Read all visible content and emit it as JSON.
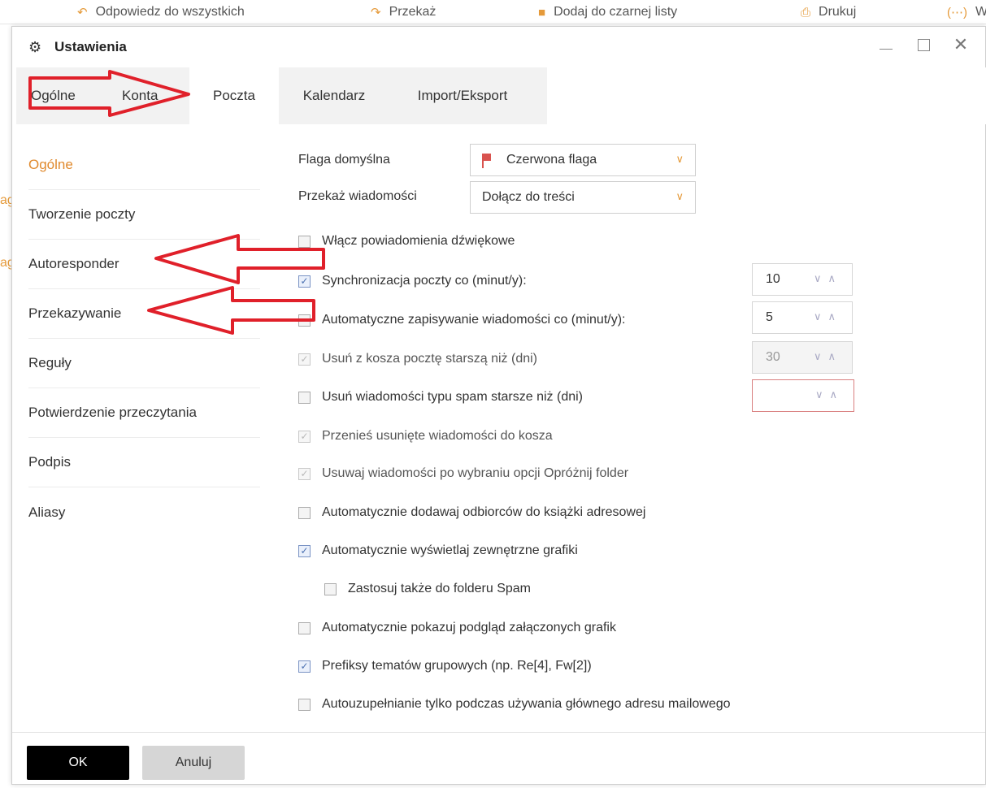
{
  "background_toolbar": {
    "items": [
      {
        "icon": "reply-all-icon",
        "label": "Odpowiedz do wszystkich"
      },
      {
        "icon": "forward-icon",
        "label": "Przekaż"
      },
      {
        "icon": "blacklist-icon",
        "label": "Dodaj do czarnej listy"
      },
      {
        "icon": "print-icon",
        "label": "Drukuj"
      },
      {
        "icon": "more-icon",
        "label": "W"
      }
    ]
  },
  "dialog": {
    "title": "Ustawienia",
    "tabs": [
      {
        "label": "Ogólne",
        "active": false
      },
      {
        "label": "Konta",
        "active": false
      },
      {
        "label": "Poczta",
        "active": true
      },
      {
        "label": "Kalendarz",
        "active": false
      },
      {
        "label": "Import/Eksport",
        "active": false
      }
    ],
    "sidenav": [
      {
        "label": "Ogólne",
        "active": true
      },
      {
        "label": "Tworzenie poczty",
        "active": false
      },
      {
        "label": "Autoresponder",
        "active": false
      },
      {
        "label": "Przekazywanie",
        "active": false
      },
      {
        "label": "Reguły",
        "active": false
      },
      {
        "label": "Potwierdzenie przeczytania",
        "active": false
      },
      {
        "label": "Podpis",
        "active": false
      },
      {
        "label": "Aliasy",
        "active": false
      }
    ],
    "fields": {
      "default_flag": {
        "label": "Flaga domyślna",
        "value": "Czerwona flaga",
        "flag_color": "#d9534f"
      },
      "forward_message": {
        "label": "Przekaż wiadomości",
        "value": "Dołącz do treści"
      }
    },
    "options": [
      {
        "label": "Włącz powiadomienia dźwiękowe",
        "checked": false,
        "disabled": false
      },
      {
        "label": "Synchronizacja poczty co (minut/y):",
        "checked": true,
        "disabled": false,
        "stepper": "10"
      },
      {
        "label": "Automatyczne zapisywanie wiadomości co (minut/y):",
        "checked": false,
        "disabled": false,
        "stepper": "5"
      },
      {
        "label": "Usuń z kosza pocztę starszą niż (dni)",
        "checked": true,
        "disabled": true,
        "stepper": "30"
      },
      {
        "label": "Usuń wiadomości typu spam starsze niż (dni)",
        "checked": false,
        "disabled": false,
        "stepper": ""
      },
      {
        "label": "Przenieś usunięte wiadomości do kosza",
        "checked": true,
        "disabled": true
      },
      {
        "label": "Usuwaj wiadomości po wybraniu opcji Opróżnij folder",
        "checked": true,
        "disabled": true
      },
      {
        "label": "Automatycznie dodawaj odbiorców do książki adresowej",
        "checked": false,
        "disabled": false
      },
      {
        "label": "Automatycznie wyświetlaj zewnętrzne grafiki",
        "checked": true,
        "disabled": false
      },
      {
        "label": "Zastosuj także do folderu Spam",
        "checked": false,
        "disabled": false
      },
      {
        "label": "Automatycznie pokazuj podgląd załączonych grafik",
        "checked": false,
        "disabled": false
      },
      {
        "label": "Prefiksy tematów grupowych (np. Re[4], Fw[2])",
        "checked": true,
        "disabled": false
      },
      {
        "label": "Autouzupełnianie tylko podczas używania głównego adresu mailowego",
        "checked": false,
        "disabled": false
      }
    ],
    "buttons": {
      "ok": "OK",
      "cancel": "Anuluj"
    }
  },
  "colors": {
    "accent": "#e08a2e",
    "annotation": "#e0202a"
  }
}
